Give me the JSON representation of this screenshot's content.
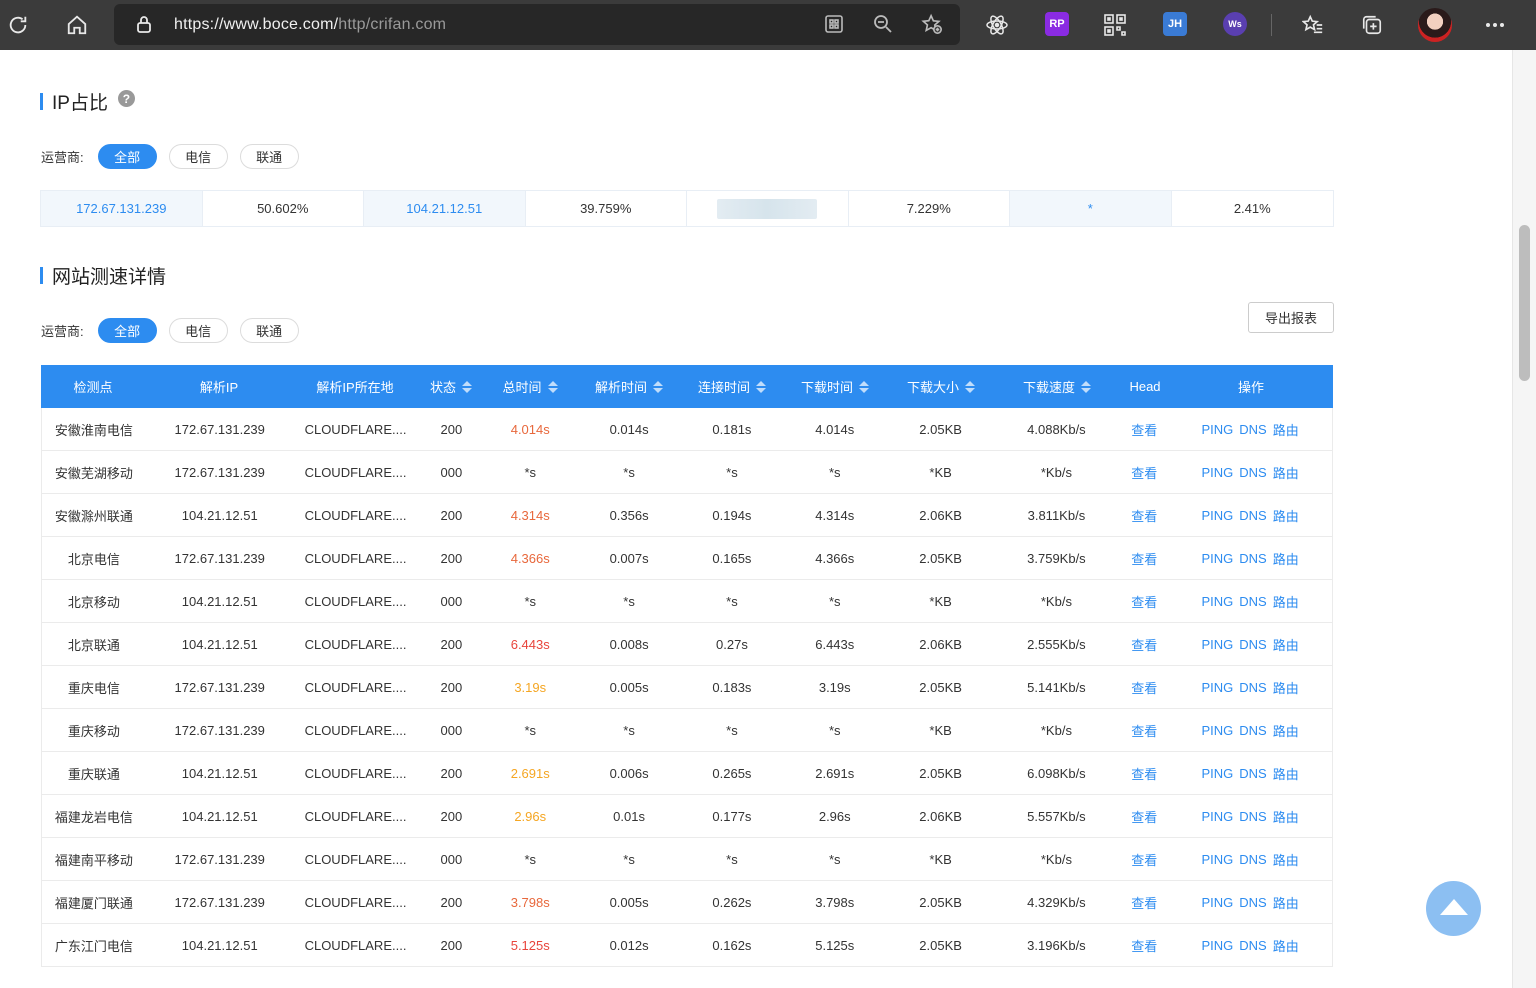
{
  "browser": {
    "url_main": "https://www.boce.com/",
    "url_rest": "http/crifan.com",
    "extensions": [
      "RP",
      "JH",
      "Ws"
    ]
  },
  "ip_section": {
    "title": "IP占比",
    "help": "?",
    "carrier_label": "运营商:",
    "carriers": [
      "全部",
      "电信",
      "联通"
    ],
    "ratios": [
      {
        "ip": "172.67.131.239",
        "percent": "50.602%"
      },
      {
        "ip": "104.21.12.51",
        "percent": "39.759%"
      },
      {
        "ip": "",
        "percent": "7.229%"
      },
      {
        "ip": "*",
        "percent": "2.41%"
      }
    ]
  },
  "speed_section": {
    "title": "网站测速详情",
    "carrier_label": "运营商:",
    "carriers": [
      "全部",
      "电信",
      "联通"
    ],
    "export_label": "导出报表",
    "columns": [
      "检测点",
      "解析IP",
      "解析IP所在地",
      "状态",
      "总时间",
      "解析时间",
      "连接时间",
      "下载时间",
      "下载大小",
      "下载速度",
      "Head",
      "操作"
    ],
    "ops": [
      "PING",
      "DNS",
      "路由"
    ],
    "view_label": "查看",
    "rows": [
      {
        "point": "安徽淮南电信",
        "ip": "172.67.131.239",
        "loc": "CLOUDFLARE....",
        "status": "200",
        "total": "4.014s",
        "tclass": "t-dark",
        "dns": "0.014s",
        "conn": "0.181s",
        "dl": "4.014s",
        "size": "2.05KB",
        "speed": "4.088Kb/s"
      },
      {
        "point": "安徽芜湖移动",
        "ip": "172.67.131.239",
        "loc": "CLOUDFLARE....",
        "status": "000",
        "total": "*s",
        "tclass": "",
        "dns": "*s",
        "conn": "*s",
        "dl": "*s",
        "size": "*KB",
        "speed": "*Kb/s"
      },
      {
        "point": "安徽滁州联通",
        "ip": "104.21.12.51",
        "loc": "CLOUDFLARE....",
        "status": "200",
        "total": "4.314s",
        "tclass": "t-dark",
        "dns": "0.356s",
        "conn": "0.194s",
        "dl": "4.314s",
        "size": "2.06KB",
        "speed": "3.811Kb/s"
      },
      {
        "point": "北京电信",
        "ip": "172.67.131.239",
        "loc": "CLOUDFLARE....",
        "status": "200",
        "total": "4.366s",
        "tclass": "t-dark",
        "dns": "0.007s",
        "conn": "0.165s",
        "dl": "4.366s",
        "size": "2.05KB",
        "speed": "3.759Kb/s"
      },
      {
        "point": "北京移动",
        "ip": "104.21.12.51",
        "loc": "CLOUDFLARE....",
        "status": "000",
        "total": "*s",
        "tclass": "",
        "dns": "*s",
        "conn": "*s",
        "dl": "*s",
        "size": "*KB",
        "speed": "*Kb/s"
      },
      {
        "point": "北京联通",
        "ip": "104.21.12.51",
        "loc": "CLOUDFLARE....",
        "status": "200",
        "total": "6.443s",
        "tclass": "t-red",
        "dns": "0.008s",
        "conn": "0.27s",
        "dl": "6.443s",
        "size": "2.06KB",
        "speed": "2.555Kb/s"
      },
      {
        "point": "重庆电信",
        "ip": "172.67.131.239",
        "loc": "CLOUDFLARE....",
        "status": "200",
        "total": "3.19s",
        "tclass": "t-orange",
        "dns": "0.005s",
        "conn": "0.183s",
        "dl": "3.19s",
        "size": "2.05KB",
        "speed": "5.141Kb/s"
      },
      {
        "point": "重庆移动",
        "ip": "172.67.131.239",
        "loc": "CLOUDFLARE....",
        "status": "000",
        "total": "*s",
        "tclass": "",
        "dns": "*s",
        "conn": "*s",
        "dl": "*s",
        "size": "*KB",
        "speed": "*Kb/s"
      },
      {
        "point": "重庆联通",
        "ip": "104.21.12.51",
        "loc": "CLOUDFLARE....",
        "status": "200",
        "total": "2.691s",
        "tclass": "t-orange",
        "dns": "0.006s",
        "conn": "0.265s",
        "dl": "2.691s",
        "size": "2.05KB",
        "speed": "6.098Kb/s"
      },
      {
        "point": "福建龙岩电信",
        "ip": "104.21.12.51",
        "loc": "CLOUDFLARE....",
        "status": "200",
        "total": "2.96s",
        "tclass": "t-orange",
        "dns": "0.01s",
        "conn": "0.177s",
        "dl": "2.96s",
        "size": "2.06KB",
        "speed": "5.557Kb/s"
      },
      {
        "point": "福建南平移动",
        "ip": "172.67.131.239",
        "loc": "CLOUDFLARE....",
        "status": "000",
        "total": "*s",
        "tclass": "",
        "dns": "*s",
        "conn": "*s",
        "dl": "*s",
        "size": "*KB",
        "speed": "*Kb/s"
      },
      {
        "point": "福建厦门联通",
        "ip": "172.67.131.239",
        "loc": "CLOUDFLARE....",
        "status": "200",
        "total": "3.798s",
        "tclass": "t-dark",
        "dns": "0.005s",
        "conn": "0.262s",
        "dl": "3.798s",
        "size": "2.05KB",
        "speed": "4.329Kb/s"
      },
      {
        "point": "广东江门电信",
        "ip": "104.21.12.51",
        "loc": "CLOUDFLARE....",
        "status": "200",
        "total": "5.125s",
        "tclass": "t-red",
        "dns": "0.012s",
        "conn": "0.162s",
        "dl": "5.125s",
        "size": "2.05KB",
        "speed": "3.196Kb/s"
      }
    ]
  }
}
